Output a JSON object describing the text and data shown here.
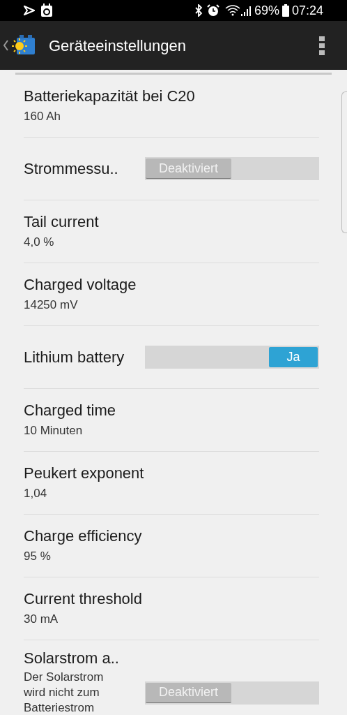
{
  "status_bar": {
    "battery_percent": "69%",
    "time": "07:24"
  },
  "app_bar": {
    "title": "Geräteeinstellungen"
  },
  "settings": [
    {
      "kind": "value",
      "title": "Batteriekapazität bei C20",
      "value": "160 Ah"
    },
    {
      "kind": "toggle",
      "title": "Strommessu..",
      "on": false,
      "toggle_label": "Deaktiviert"
    },
    {
      "kind": "value",
      "title": "Tail current",
      "value": "4,0 %"
    },
    {
      "kind": "value",
      "title": "Charged voltage",
      "value": "14250 mV"
    },
    {
      "kind": "toggle",
      "title": "Lithium battery",
      "on": true,
      "toggle_label": "Ja"
    },
    {
      "kind": "value",
      "title": "Charged time",
      "value": "10 Minuten"
    },
    {
      "kind": "value",
      "title": "Peukert exponent",
      "value": "1,04"
    },
    {
      "kind": "value",
      "title": "Charge efficiency",
      "value": "95 %"
    },
    {
      "kind": "value",
      "title": "Current threshold",
      "value": "30 mA"
    },
    {
      "kind": "toggle",
      "title": "Solarstrom a..",
      "description": "Der Solarstrom wird nicht zum Batteriestrom",
      "on": false,
      "toggle_label": "Deaktiviert"
    }
  ]
}
